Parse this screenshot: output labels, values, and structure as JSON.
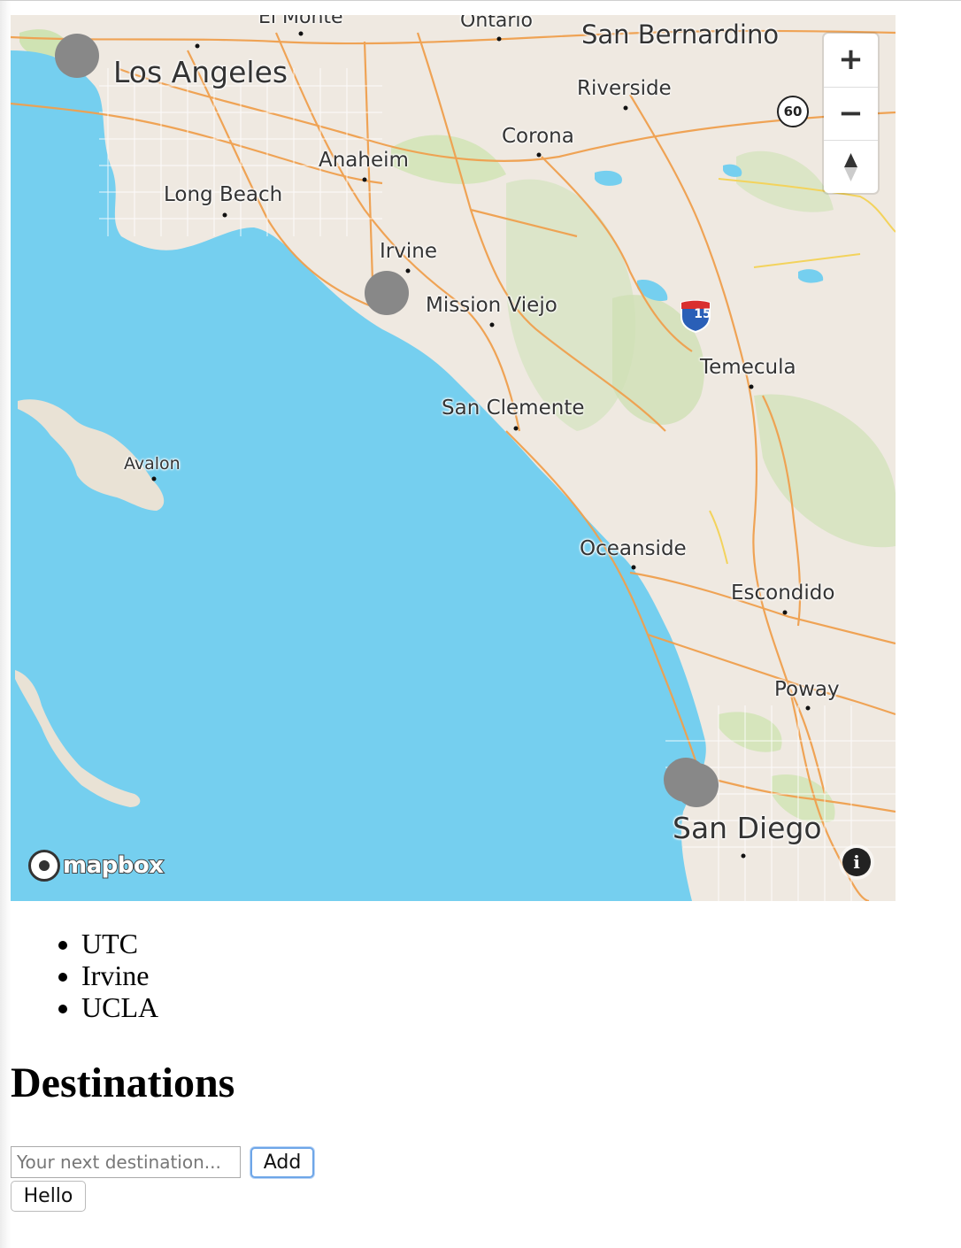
{
  "map": {
    "attribution_logo": "mapbox",
    "controls": {
      "zoom_in": "+",
      "zoom_out": "−",
      "compass": "▲"
    },
    "info_glyph": "i",
    "route_shields": {
      "state_route": "60",
      "interstate": "15"
    },
    "place_labels": [
      {
        "name": "El Monte"
      },
      {
        "name": "Ontario"
      },
      {
        "name": "San Bernardino"
      },
      {
        "name": "Los Angeles"
      },
      {
        "name": "Riverside"
      },
      {
        "name": "Corona"
      },
      {
        "name": "Anaheim"
      },
      {
        "name": "Long Beach"
      },
      {
        "name": "Irvine"
      },
      {
        "name": "Mission Viejo"
      },
      {
        "name": "Temecula"
      },
      {
        "name": "San Clemente"
      },
      {
        "name": "Avalon"
      },
      {
        "name": "Oceanside"
      },
      {
        "name": "Escondido"
      },
      {
        "name": "Poway"
      },
      {
        "name": "San Diego"
      }
    ],
    "markers": [
      {
        "name": "UCLA"
      },
      {
        "name": "Irvine"
      },
      {
        "name": "UTC"
      }
    ],
    "colors": {
      "water": "#75cfef",
      "land": "#efe9e1",
      "park": "#cfe3b3",
      "road": "#f0a04e",
      "marker": "#888888"
    }
  },
  "destinations": {
    "items": [
      "UTC",
      "Irvine",
      "UCLA"
    ],
    "heading": "Destinations",
    "input_placeholder": "Your next destination...",
    "input_value": "",
    "add_button": "Add",
    "hello_button": "Hello"
  }
}
